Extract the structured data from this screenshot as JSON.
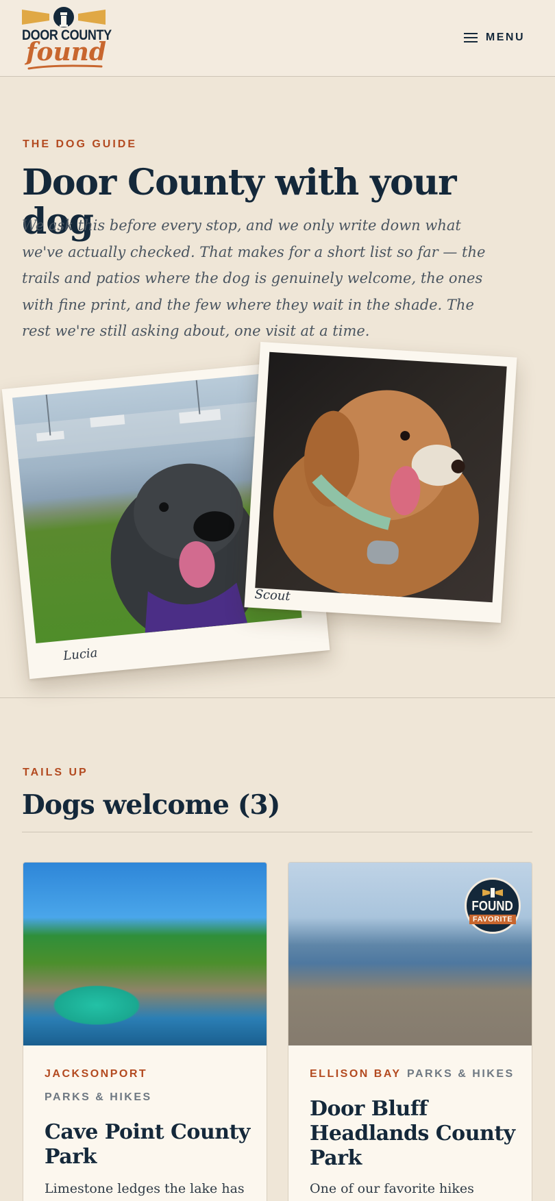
{
  "header": {
    "logo": {
      "line1": "DOOR COUNTY",
      "line2": "found"
    },
    "menu_label": "MENU"
  },
  "hero": {
    "eyebrow": "THE DOG GUIDE",
    "title": "Door County with your dog",
    "intro": "We ask this before every stop, and we only write down what we've actually checked. That makes for a short list so far — the trails and patios where the dog is genuinely welcome, the ones with fine print, and the few where they wait in the shade. The rest we're still asking about, one visit at a time.",
    "photos": [
      {
        "caption": "Lucia"
      },
      {
        "caption": "Scout"
      }
    ]
  },
  "section": {
    "eyebrow": "TAILS UP",
    "title": "Dogs welcome (3)"
  },
  "cards": [
    {
      "location": "JACKSONPORT",
      "category": "PARKS & HIKES",
      "title": "Cave Point County Park",
      "description": "Limestone ledges the lake has"
    },
    {
      "location": "ELLISON BAY",
      "category": "PARKS & HIKES",
      "title": "Door Bluff Headlands County Park",
      "description": "One of our favorite hikes",
      "badge": {
        "top": "FOUND",
        "bottom": "FAVORITE"
      }
    }
  ]
}
